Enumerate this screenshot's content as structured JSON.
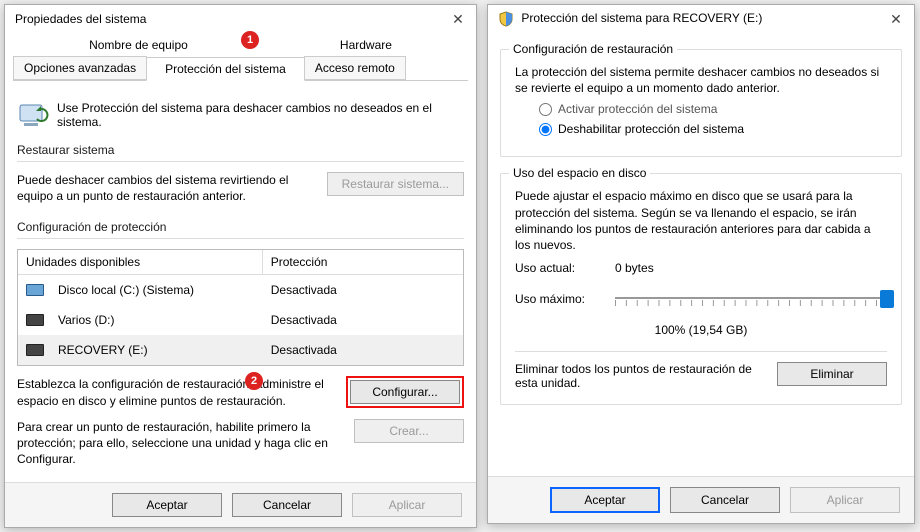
{
  "win1": {
    "title": "Propiedades del sistema",
    "tabs_top": {
      "t1": "Nombre de equipo",
      "t2": "Hardware"
    },
    "tabs2": {
      "t1": "Opciones avanzadas",
      "t2": "Protección del sistema",
      "t3": "Acceso remoto"
    },
    "badge1": "1",
    "info": "Use Protección del sistema para deshacer cambios no deseados en el sistema.",
    "restore": {
      "title": "Restaurar sistema",
      "desc": "Puede deshacer cambios del sistema revirtiendo el equipo a un punto de restauración anterior.",
      "btn": "Restaurar sistema..."
    },
    "protect": {
      "title": "Configuración de protección",
      "hdr1": "Unidades disponibles",
      "hdr2": "Protección",
      "drives": [
        {
          "name": "Disco local (C:) (Sistema)",
          "status": "Desactivada"
        },
        {
          "name": "Varios (D:)",
          "status": "Desactivada"
        },
        {
          "name": "RECOVERY (E:)",
          "status": "Desactivada"
        }
      ],
      "config_desc": "Establezca la configuración de restauración, administre el espacio en disco y elimine puntos de restauración.",
      "badge2": "2",
      "config_btn": "Configurar...",
      "create_desc": "Para crear un punto de restauración, habilite primero la protección; para ello, seleccione una unidad y haga clic en Configurar.",
      "create_btn": "Crear..."
    },
    "footer": {
      "ok": "Aceptar",
      "cancel": "Cancelar",
      "apply": "Aplicar"
    }
  },
  "win2": {
    "title": "Protección del sistema para RECOVERY (E:)",
    "section1": {
      "title": "Configuración de restauración",
      "desc": "La protección del sistema permite deshacer cambios no deseados si se revierte el equipo a un momento dado anterior.",
      "opt_on": "Activar protección del sistema",
      "opt_off": "Deshabilitar protección del sistema"
    },
    "section2": {
      "title": "Uso del espacio en disco",
      "desc": "Puede ajustar el espacio máximo en disco que se usará para la protección del sistema. Según se va llenando el espacio, se irán eliminando los puntos de restauración anteriores para dar cabida a los nuevos.",
      "current_label": "Uso actual:",
      "current_value": "0 bytes",
      "max_label": "Uso máximo:",
      "slider_text": "100% (19,54 GB)",
      "delete_desc": "Eliminar todos los puntos de restauración de esta unidad.",
      "delete_btn": "Eliminar"
    },
    "footer": {
      "ok": "Aceptar",
      "cancel": "Cancelar",
      "apply": "Aplicar"
    }
  }
}
